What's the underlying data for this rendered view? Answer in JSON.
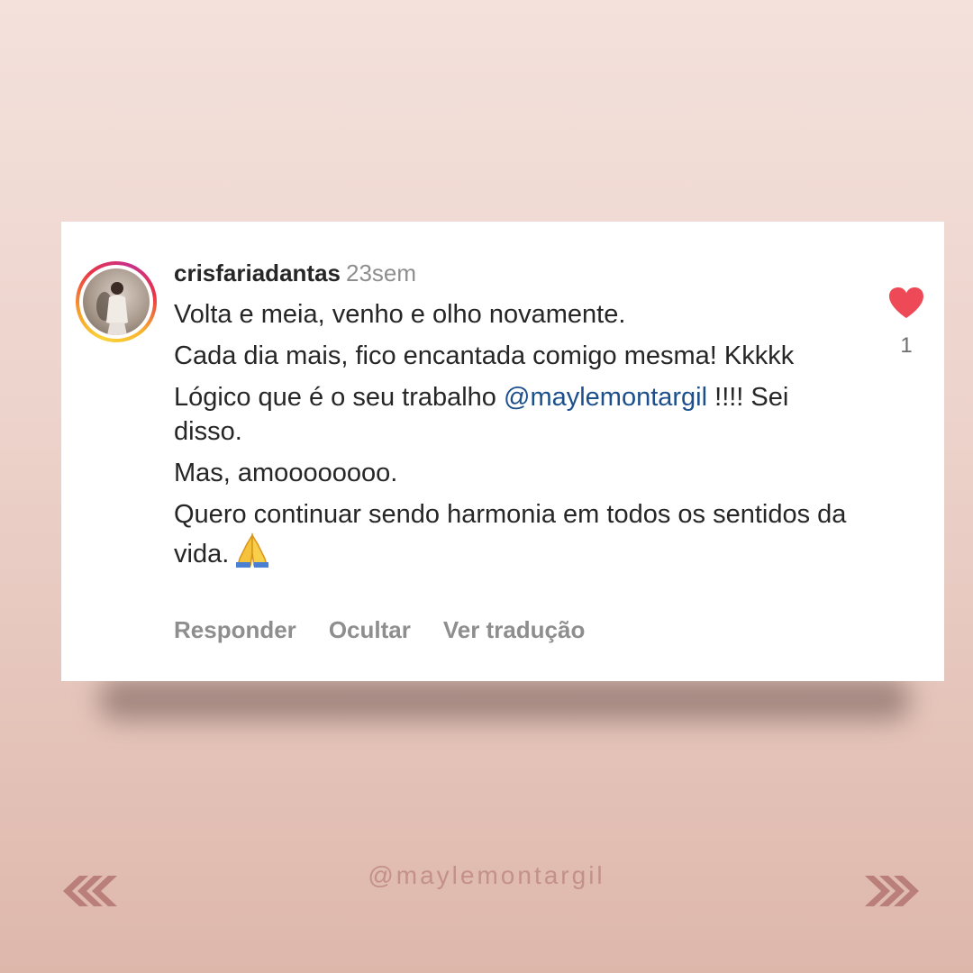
{
  "comment": {
    "username": "crisfariadantas",
    "time_ago": "23sem",
    "lines": [
      "Volta e meia, venho e olho novamente.",
      "Cada dia mais, fico encantada comigo mesma! Kkkkk",
      "Lógico que é o seu trabalho ",
      "Mas, amoooooooo.",
      "Quero continuar sendo harmonia em todos os sentidos da vida."
    ],
    "mention": "@maylemontargil",
    "mention_suffix": " !!!! Sei disso.",
    "emoji": "folded-hands-icon",
    "like_count": "1",
    "liked": true
  },
  "actions": {
    "reply": "Responder",
    "hide": "Ocultar",
    "translate": "Ver tradução"
  },
  "footer": {
    "handle": "@maylemontargil"
  },
  "colors": {
    "heart": "#ed4956",
    "mention": "#1d4f8c",
    "arrows": "#b97f78",
    "handle": "#c49188"
  }
}
